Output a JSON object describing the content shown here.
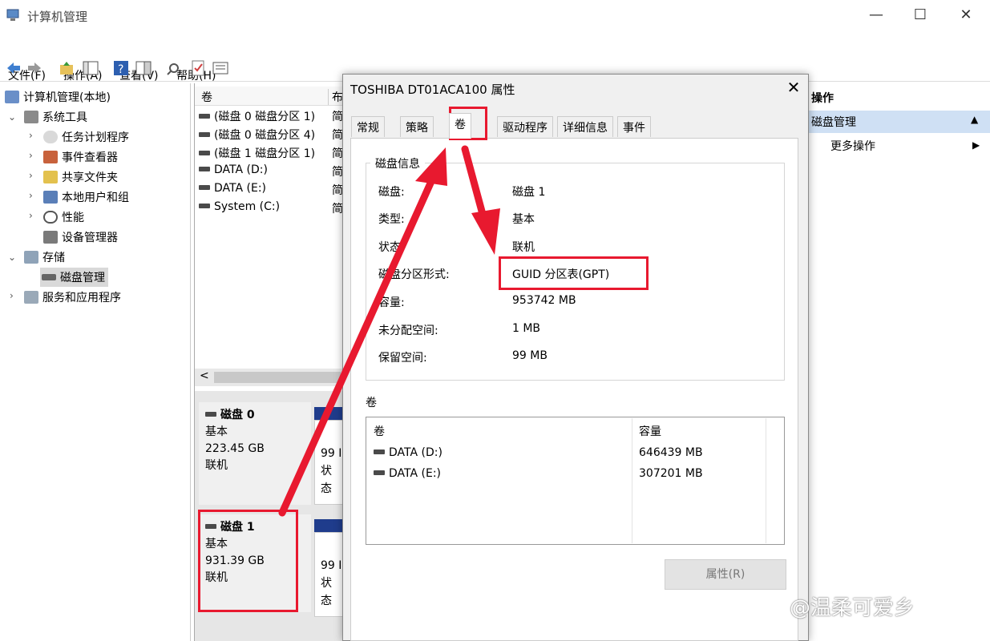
{
  "window": {
    "title": "计算机管理",
    "minimize": "—",
    "maximize": "☐",
    "close": "✕"
  },
  "menu": [
    "文件(F)",
    "操作(A)",
    "查看(V)",
    "帮助(H)"
  ],
  "tree": {
    "root": "计算机管理(本地)",
    "items": [
      {
        "label": "系统工具"
      },
      {
        "label": "任务计划程序"
      },
      {
        "label": "事件查看器"
      },
      {
        "label": "共享文件夹"
      },
      {
        "label": "本地用户和组"
      },
      {
        "label": "性能"
      },
      {
        "label": "设备管理器"
      },
      {
        "label": "存储"
      },
      {
        "label": "磁盘管理"
      },
      {
        "label": "服务和应用程序"
      }
    ]
  },
  "volumes": {
    "col_volume": "卷",
    "col_layout": "布",
    "rows": [
      {
        "name": "(磁盘 0 磁盘分区 1)",
        "layout": "简"
      },
      {
        "name": "(磁盘 0 磁盘分区 4)",
        "layout": "简"
      },
      {
        "name": "(磁盘 1 磁盘分区 1)",
        "layout": "简"
      },
      {
        "name": "DATA (D:)",
        "layout": "简"
      },
      {
        "name": "DATA (E:)",
        "layout": "简"
      },
      {
        "name": "System (C:)",
        "layout": "简"
      }
    ],
    "scroll_left": "<"
  },
  "disks": [
    {
      "name": "磁盘 0",
      "type": "基本",
      "size": "223.45 GB",
      "status": "联机",
      "part_size": "99 I",
      "part_status": "状态"
    },
    {
      "name": "磁盘 1",
      "type": "基本",
      "size": "931.39 GB",
      "status": "联机",
      "part_size": "99 I",
      "part_status": "状态"
    }
  ],
  "actions": {
    "header": "操作",
    "selected": "磁盘管理",
    "selected_arrow": "▲",
    "more": "更多操作",
    "more_arrow": "▶"
  },
  "dialog": {
    "title": "TOSHIBA DT01ACA100 属性",
    "close": "✕",
    "tabs": [
      "常规",
      "策略",
      "卷",
      "驱动程序",
      "详细信息",
      "事件"
    ],
    "active_tab": "卷",
    "info_group": "磁盘信息",
    "info": [
      {
        "label": "磁盘:",
        "value": "磁盘 1"
      },
      {
        "label": "类型:",
        "value": "基本"
      },
      {
        "label": "状态:",
        "value": "联机"
      },
      {
        "label": "磁盘分区形式:",
        "value": "GUID 分区表(GPT)"
      },
      {
        "label": "容量:",
        "value": "953742 MB"
      },
      {
        "label": "未分配空间:",
        "value": "1 MB"
      },
      {
        "label": "保留空间:",
        "value": "99 MB"
      }
    ],
    "volumes_label": "卷",
    "vol_table": {
      "col_volume": "卷",
      "col_capacity": "容量",
      "rows": [
        {
          "name": "DATA (D:)",
          "capacity": "646439 MB"
        },
        {
          "name": "DATA (E:)",
          "capacity": "307201 MB"
        }
      ]
    },
    "properties_button": "属性(R)"
  },
  "watermark": "@温柔可爱乡",
  "colors": {
    "annotation_red": "#e8192f",
    "selection_blue": "#cfe0f4",
    "partition_bar": "#1f3c8c"
  }
}
